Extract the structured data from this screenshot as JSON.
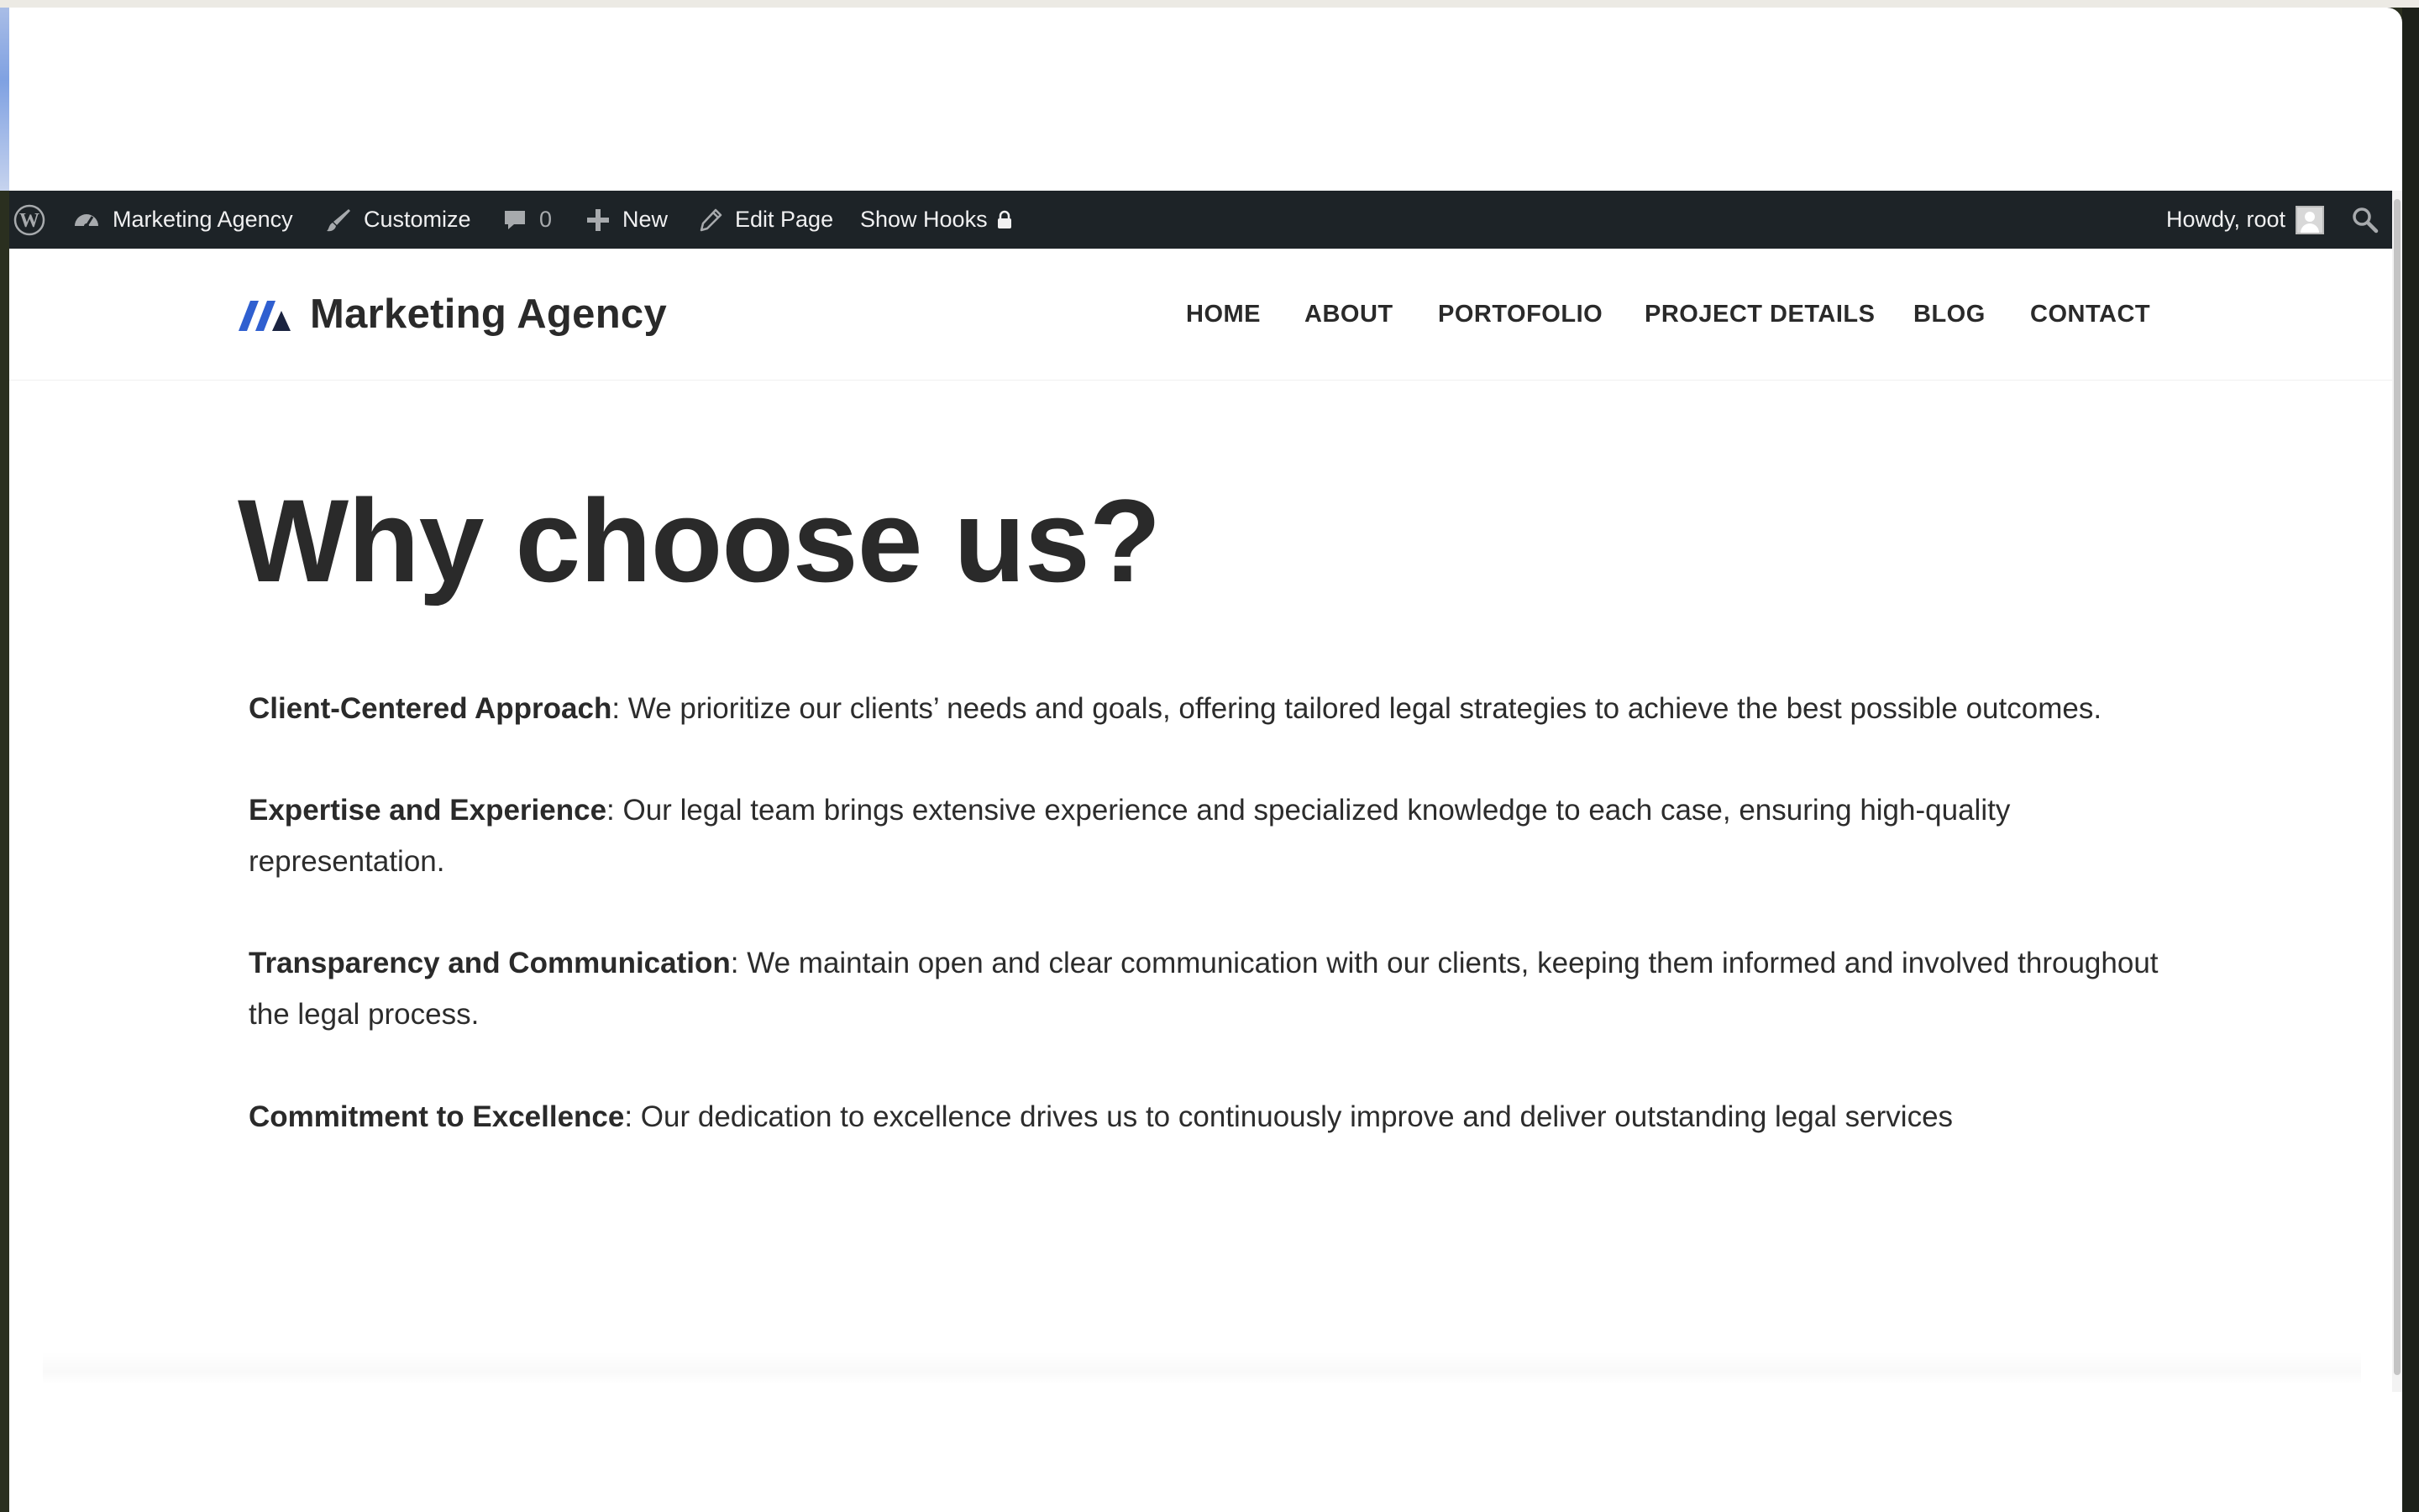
{
  "adminbar": {
    "wp_logo_icon": "wordpress-icon",
    "site_name": "Marketing Agency",
    "customize": "Customize",
    "comments_count": "0",
    "new": "New",
    "edit_page": "Edit Page",
    "show_hooks": "Show Hooks",
    "howdy": "Howdy, root"
  },
  "header": {
    "site_title": "Marketing Agency",
    "nav": [
      "HOME",
      "ABOUT",
      "PORTOFOLIO",
      "PROJECT DETAILS",
      "BLOG",
      "CONTACT"
    ]
  },
  "content": {
    "title": "Why choose us?",
    "items": [
      {
        "label": "Client-Centered Approach",
        "text": ": We prioritize our clients’ needs and goals, offering tailored legal strategies to achieve the best possible outcomes."
      },
      {
        "label": "Expertise and Experience",
        "text": ": Our legal team brings extensive experience and specialized knowledge to each case, ensuring high-quality representation."
      },
      {
        "label": "Transparency and Communication",
        "text": ": We maintain open and clear communication with our clients, keeping them informed and involved throughout the legal process."
      },
      {
        "label": "Commitment to Excellence",
        "text": ": Our dedication to excellence drives us to continuously improve and deliver outstanding legal services"
      }
    ]
  },
  "colors": {
    "adminbar_bg": "#1d2327",
    "logo_blue": "#2f5fd0",
    "logo_dark": "#1a2340",
    "text": "#2a2a2a"
  }
}
